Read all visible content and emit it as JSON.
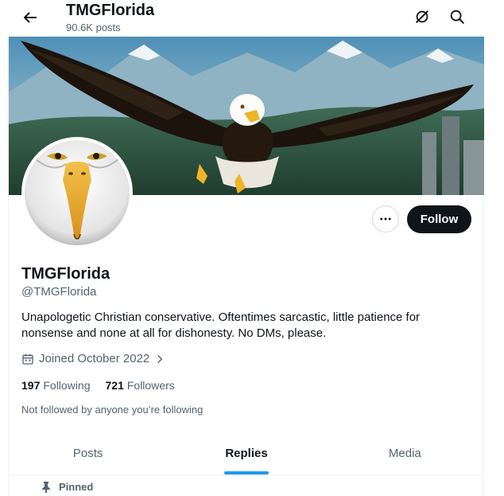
{
  "header": {
    "title": "TMGFlorida",
    "post_count": "90.6K posts"
  },
  "profile": {
    "display_name": "TMGFlorida",
    "handle": "@TMGFlorida",
    "bio": "Unapologetic Christian conservative. Oftentimes sarcastic, little patience for nonsense and none at all for dishonesty. No DMs, please.",
    "joined": "Joined October 2022",
    "following_count": "197",
    "following_label": "Following",
    "followers_count": "721",
    "followers_label": "Followers",
    "not_followed_text": "Not followed by anyone you’re following"
  },
  "actions": {
    "follow_label": "Follow"
  },
  "tabs": [
    {
      "label": "Posts",
      "active": false
    },
    {
      "label": "Replies",
      "active": true
    },
    {
      "label": "Media",
      "active": false
    }
  ],
  "pinned_label": "Pinned",
  "colors": {
    "accent": "#1d9bf0",
    "text_primary": "#0f1419",
    "text_secondary": "#536471",
    "follow_button_bg": "#0f1419"
  },
  "icons": [
    "back-arrow-icon",
    "grok-icon",
    "search-icon",
    "more-icon",
    "calendar-icon",
    "chevron-right-icon",
    "pin-icon"
  ]
}
